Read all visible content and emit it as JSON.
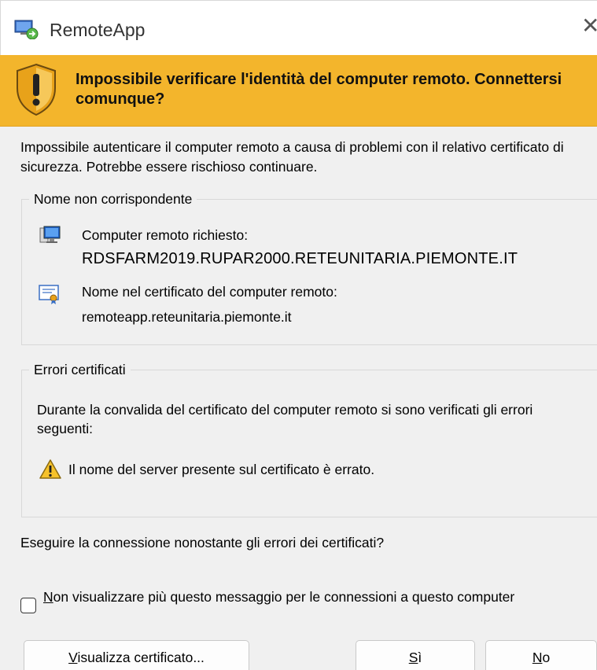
{
  "window": {
    "title": "RemoteApp",
    "close_glyph": "✕"
  },
  "banner": {
    "title": "Impossibile verificare l'identità del computer remoto. Connettersi comunque?",
    "icon": "warning-shield-icon",
    "background_color": "#f3b52c"
  },
  "intro": "Impossibile autenticare il computer remoto a causa di problemi con il relativo certificato di sicurezza. Potrebbe essere rischioso continuare.",
  "name_mismatch": {
    "legend": "Nome non corrispondente",
    "requested_label": "Computer remoto richiesto:",
    "requested_value": "RDSFARM2019.RUPAR2000.RETEUNITARIA.PIEMONTE.IT",
    "cert_label": "Nome nel certificato del computer remoto:",
    "cert_value": "remoteapp.reteunitaria.piemonte.it"
  },
  "cert_errors": {
    "legend": "Errori certificati",
    "description": "Durante la convalida del certificato del computer remoto si sono verificati gli errori seguenti:",
    "error_1": "Il nome del server presente sul certificato è errato."
  },
  "question": "Eseguire la connessione nonostante gli errori dei certificati?",
  "checkbox": {
    "label_first": "N",
    "label_rest": "on visualizzare più questo messaggio per le connessioni a questo computer",
    "checked": false
  },
  "buttons": {
    "view_cert_first": "V",
    "view_cert_rest": "isualizza certificato...",
    "yes_first": "S",
    "yes_rest": "ì",
    "no_first": "N",
    "no_rest": "o"
  }
}
